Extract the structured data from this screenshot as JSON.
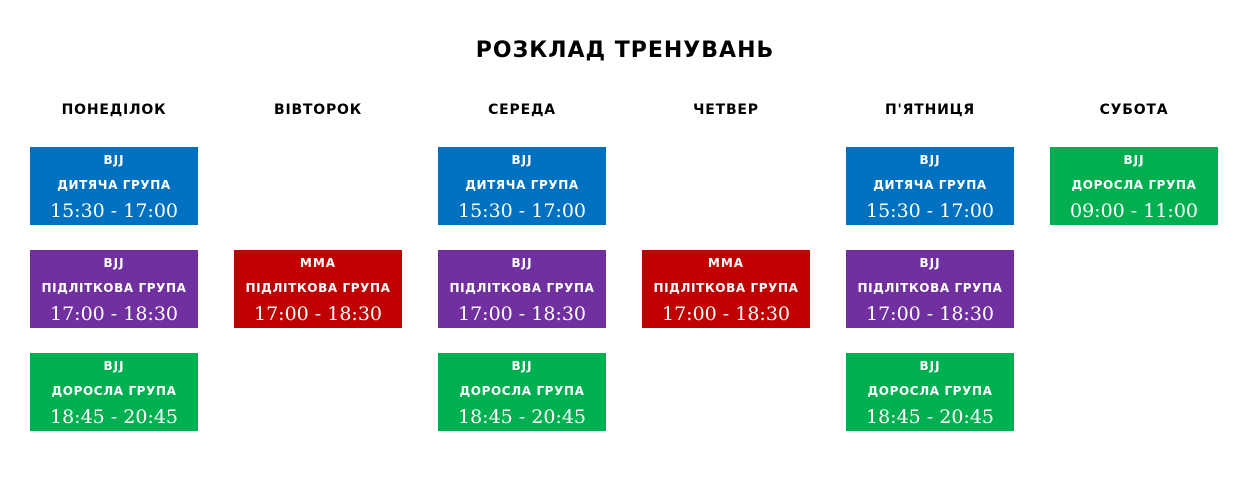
{
  "title": "РОЗКЛАД ТРЕНУВАНЬ",
  "days": [
    "ПОНЕДІЛОК",
    "ВІВТОРОК",
    "СЕРЕДА",
    "ЧЕТВЕР",
    "П'ЯТНИЦЯ",
    "СУБОТА"
  ],
  "colors": {
    "kids": "#0070c0",
    "teens_bjj": "#7030a0",
    "adults": "#00b050",
    "mma": "#c00000"
  },
  "classes": {
    "mon_1": {
      "sport": "BJJ",
      "group": "ДИТЯЧА ГРУПА",
      "time": "15:30 - 17:00"
    },
    "mon_2": {
      "sport": "BJJ",
      "group": "ПІДЛІТКОВА ГРУПА",
      "time": "17:00 - 18:30"
    },
    "mon_3": {
      "sport": "BJJ",
      "group": "ДОРОСЛА ГРУПА",
      "time": "18:45 - 20:45"
    },
    "tue_2": {
      "sport": "MMA",
      "group": "ПІДЛІТКОВА ГРУПА",
      "time": "17:00 - 18:30"
    },
    "wed_1": {
      "sport": "BJJ",
      "group": "ДИТЯЧА ГРУПА",
      "time": "15:30 - 17:00"
    },
    "wed_2": {
      "sport": "BJJ",
      "group": "ПІДЛІТКОВА ГРУПА",
      "time": "17:00 - 18:30"
    },
    "wed_3": {
      "sport": "BJJ",
      "group": "ДОРОСЛА ГРУПА",
      "time": "18:45 - 20:45"
    },
    "thu_2": {
      "sport": "MMA",
      "group": "ПІДЛІТКОВА ГРУПА",
      "time": "17:00 - 18:30"
    },
    "fri_1": {
      "sport": "BJJ",
      "group": "ДИТЯЧА ГРУПА",
      "time": "15:30 - 17:00"
    },
    "fri_2": {
      "sport": "BJJ",
      "group": "ПІДЛІТКОВА ГРУПА",
      "time": "17:00 - 18:30"
    },
    "fri_3": {
      "sport": "BJJ",
      "group": "ДОРОСЛА ГРУПА",
      "time": "18:45 - 20:45"
    },
    "sat_1": {
      "sport": "BJJ",
      "group": "ДОРОСЛА ГРУПА",
      "time": "09:00 - 11:00"
    }
  }
}
